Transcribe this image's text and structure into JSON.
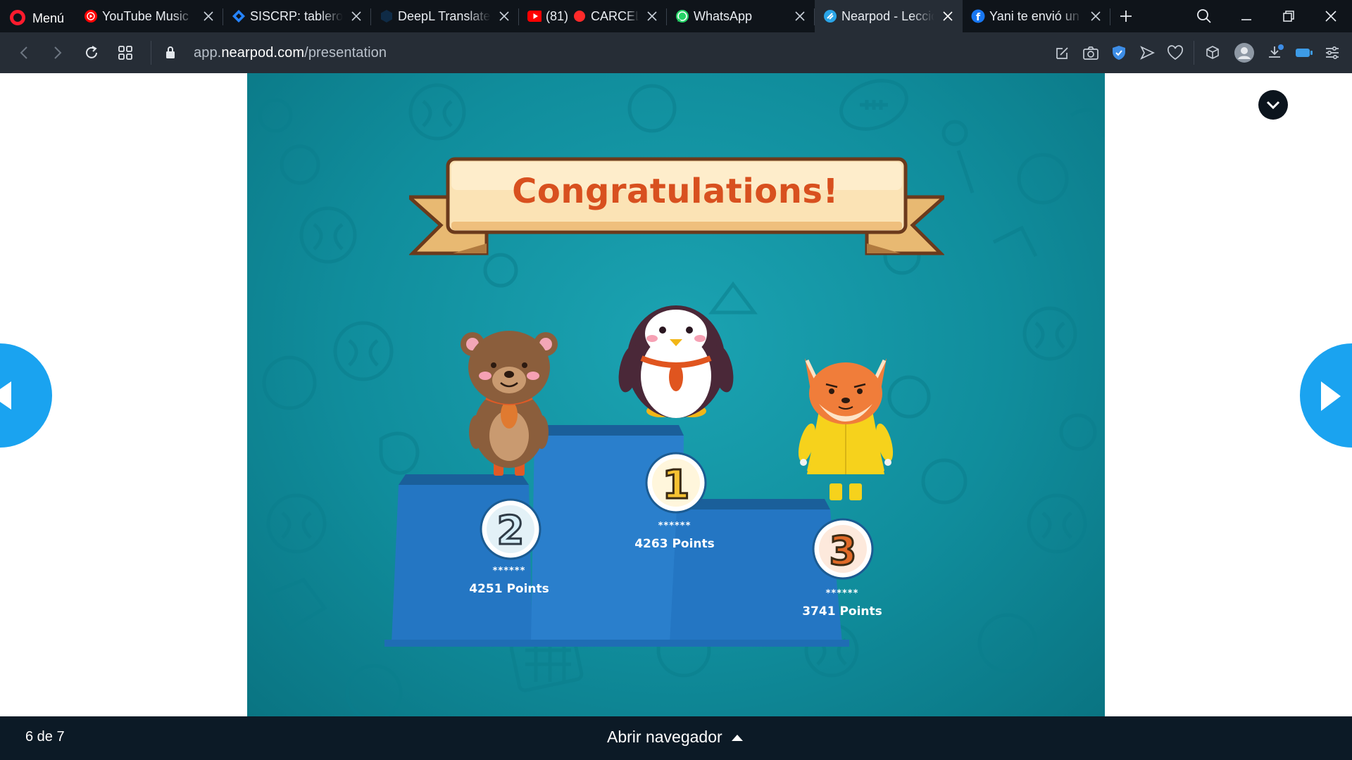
{
  "browser": {
    "menu_label": "Menú",
    "tabs": [
      {
        "title": "YouTube Music",
        "icon": "youtube-music-icon",
        "active": false
      },
      {
        "title": "SISCRP: tablero de",
        "icon": "jira-icon",
        "active": false
      },
      {
        "title": "DeepL Translate",
        "icon": "deepl-icon",
        "active": false
      },
      {
        "title": "(81)",
        "extra_title": "CARCEL",
        "icon": "youtube-icon",
        "recording": true,
        "active": false
      },
      {
        "title": "WhatsApp",
        "icon": "whatsapp-icon",
        "active": false
      },
      {
        "title": "Nearpod - Lección",
        "icon": "nearpod-icon",
        "active": true
      },
      {
        "title": "Yani te envió un",
        "icon": "facebook-icon",
        "active": false
      }
    ],
    "url_domain_prefix": "app.",
    "url_domain": "nearpod.com",
    "url_path": "/presentation"
  },
  "slide": {
    "banner_text": "Congratulations!",
    "podium": [
      {
        "place": 2,
        "name": "******",
        "points": "4251 Points",
        "character": "bear"
      },
      {
        "place": 1,
        "name": "******",
        "points": "4263 Points",
        "character": "penguin"
      },
      {
        "place": 3,
        "name": "******",
        "points": "3741 Points",
        "character": "fox"
      }
    ]
  },
  "footer": {
    "page_count": "6 de 7",
    "open_navigator": "Abrir navegador"
  },
  "colors": {
    "slide_bg": "#108d9c",
    "podium": "#2476c3",
    "nav_arrow": "#1aa3f0",
    "banner_text": "#d8501f"
  }
}
